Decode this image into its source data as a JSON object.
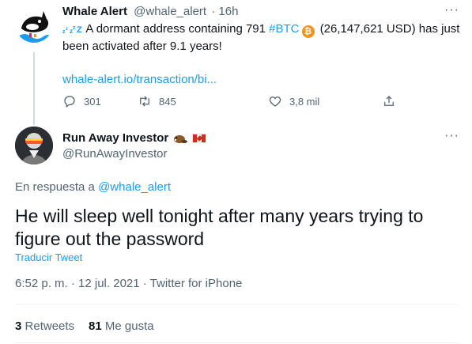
{
  "parent_tweet": {
    "author_name": "Whale Alert",
    "author_handle": "@whale_alert",
    "time": "· 16h",
    "text_prefix_icon": "zzz-sleep-icon",
    "text_part1": "A dormant address containing 791",
    "hashtag": "#BTC",
    "coin_icon": "bitcoin-icon",
    "text_part2": "(26,147,621 USD) has just been activated after 9.1 years!",
    "link": "whale-alert.io/transaction/bi...",
    "replies": "301",
    "retweets": "845",
    "likes": "3,8 mil",
    "more": "···"
  },
  "reply_tweet": {
    "author_name": "Run Away Investor",
    "author_handle": "@RunAwayInvestor",
    "badge_icons": [
      "beaver-emoji-icon",
      "canada-flag-icon"
    ],
    "replying_prefix": "En respuesta a",
    "replying_to": "@whale_alert",
    "text": "He will sleep well tonight after many years trying to figure out the password",
    "translate_label": "Traducir Tweet",
    "meta": "6:52 p. m. · 12 jul. 2021 · Twitter for iPhone",
    "retweets_count": "3",
    "retweets_label": "Retweets",
    "likes_count": "81",
    "likes_label": "Me gusta",
    "more": "···"
  },
  "colors": {
    "link": "#1d9bf0",
    "secondary_text": "#536471",
    "primary_text": "#0f1419",
    "bitcoin": "#f7931a",
    "thread_line": "#cfd9de"
  }
}
